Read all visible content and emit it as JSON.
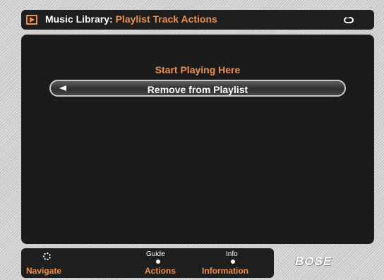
{
  "header": {
    "title_lead": "Music Library:",
    "title_sub": "Playlist Track Actions",
    "left_icon": "play-box-icon",
    "right_icon": "repeat-icon"
  },
  "menu": {
    "items": [
      {
        "label": "Start Playing Here",
        "selected": false
      },
      {
        "label": "Remove from Playlist",
        "selected": true
      }
    ],
    "selected_marker_icon": "arrow-left-icon"
  },
  "footer": {
    "navigate": {
      "label": "Navigate",
      "icon": "navigate-ring-icon"
    },
    "actions": {
      "label": "Actions",
      "hint": "Guide"
    },
    "information": {
      "label": "Information",
      "hint": "Info"
    }
  },
  "brand": {
    "logo_text": "BOSE"
  },
  "colors": {
    "accent": "#f0904d",
    "panel_bg": "#1b1b1b",
    "text": "#ffffff",
    "selection_border": "#c8c8c8"
  }
}
